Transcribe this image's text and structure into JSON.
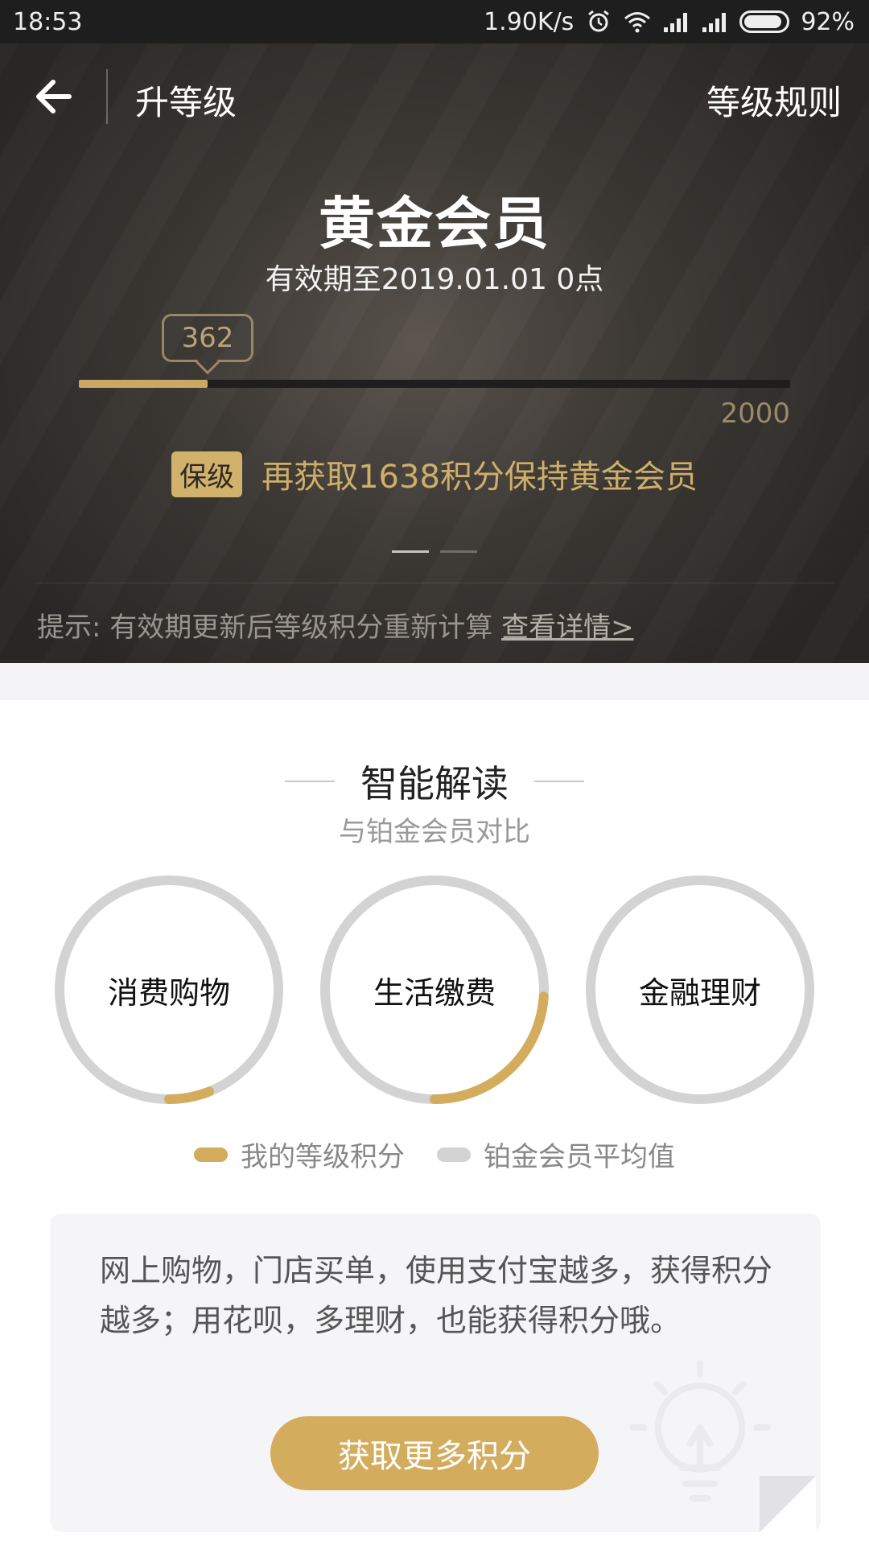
{
  "status_bar": {
    "time": "18:53",
    "net_speed": "1.90K/s",
    "battery": "92%"
  },
  "nav": {
    "title": "升等级",
    "rules_label": "等级规则"
  },
  "level": {
    "name": "黄金会员",
    "validity": "有效期至2019.01.01 0点",
    "current_points": "362",
    "max_points": "2000",
    "progress_fraction": 0.181,
    "keep_badge": "保级",
    "keep_text": "再获取1638积分保持黄金会员"
  },
  "carousel": {
    "count": 2,
    "active": 0
  },
  "tip": {
    "text": "提示: 有效期更新后等级积分重新计算 ",
    "link": "查看详情>"
  },
  "analysis": {
    "title": "智能解读",
    "subtitle": "与铂金会员对比",
    "categories": [
      {
        "label": "消费购物",
        "my_fraction": 0.06
      },
      {
        "label": "生活缴费",
        "my_fraction": 0.24
      },
      {
        "label": "金融理财",
        "my_fraction": 0.0
      }
    ],
    "legend": {
      "mine": "我的等级积分",
      "platinum": "铂金会员平均值"
    },
    "colors": {
      "mine": "#d4ac5d",
      "platinum": "#d3d3d3"
    }
  },
  "info": {
    "text": "网上购物，门店买单，使用支付宝越多，获得积分越多；用花呗，多理财，也能获得积分哦。",
    "button": "获取更多积分"
  },
  "colors": {
    "gold": "#c8a865",
    "hero_dark": "#2a2826"
  }
}
